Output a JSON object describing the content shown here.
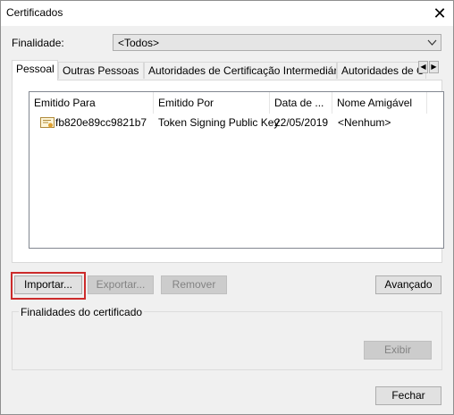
{
  "window": {
    "title": "Certificados"
  },
  "purpose": {
    "label": "Finalidade:",
    "selected": "<Todos>"
  },
  "tabs": [
    {
      "label": "Pessoal"
    },
    {
      "label": "Outras Pessoas"
    },
    {
      "label": "Autoridades de Certificação Intermediárias"
    },
    {
      "label": "Autoridades de Ce"
    }
  ],
  "table": {
    "columns": [
      "Emitido Para",
      "Emitido Por",
      "Data de ...",
      "Nome Amigável"
    ],
    "rows": [
      {
        "issued_to": "fb820e89cc9821b7",
        "issued_by": "Token Signing Public Key",
        "date": "22/05/2019",
        "friendly_name": "<Nenhum>"
      }
    ]
  },
  "buttons": {
    "import": "Importar...",
    "export": "Exportar...",
    "remove": "Remover",
    "advanced": "Avançado",
    "view": "Exibir",
    "close": "Fechar"
  },
  "purposes_group": {
    "title": "Finalidades do certificado"
  },
  "colors": {
    "highlight": "#cc2b2b"
  }
}
